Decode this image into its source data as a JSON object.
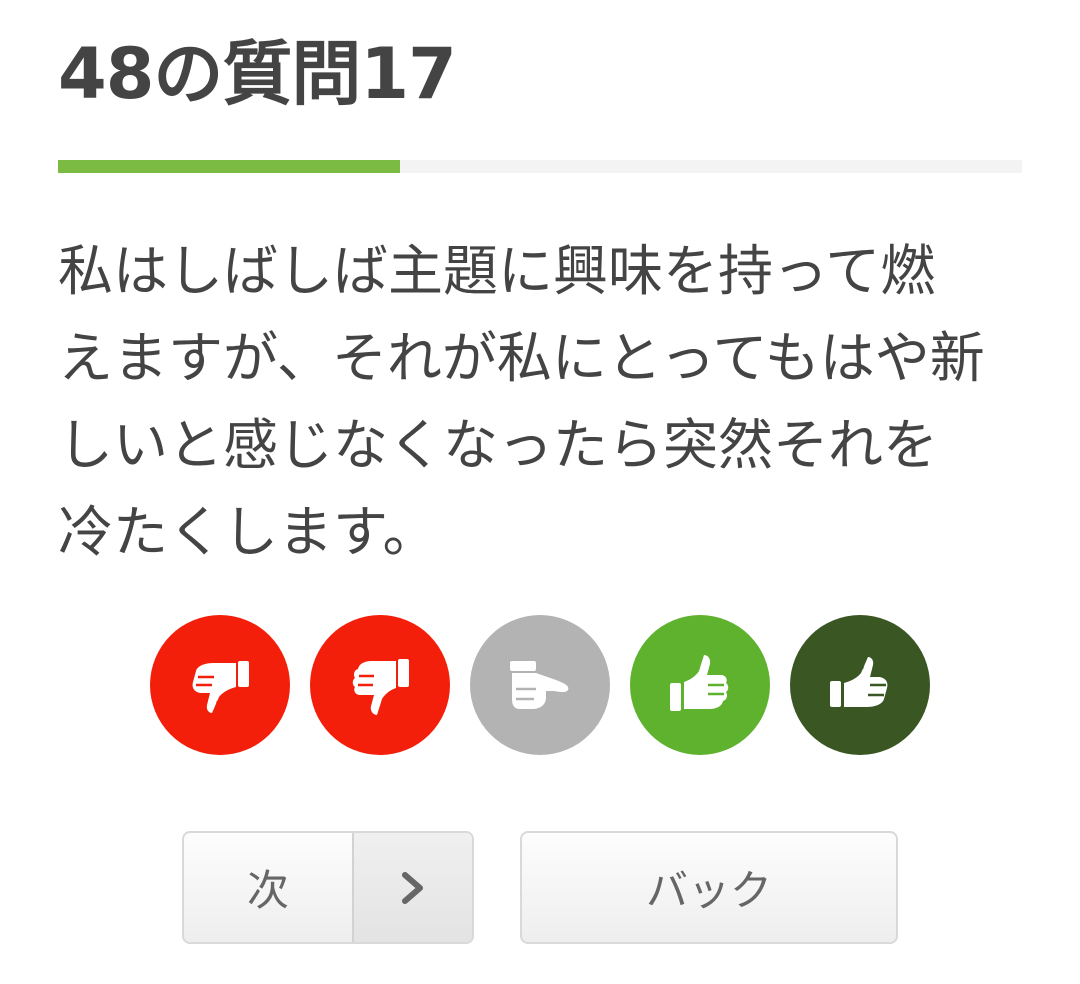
{
  "title": "48の質問17",
  "progress": {
    "fraction": 0.355
  },
  "question": {
    "text": "私はしばしば主題に興味を持って燃えますが、それが私にとってもはや新しいと感じなくなったら突然それを冷たくします。"
  },
  "answers": [
    {
      "icon": "double-thumbs-down-icon",
      "color": "#f41f0a"
    },
    {
      "icon": "thumbs-down-icon",
      "color": "#f41f0a"
    },
    {
      "icon": "thumb-sideways-icon",
      "color": "#b3b3b3"
    },
    {
      "icon": "thumbs-up-icon",
      "color": "#5fb22e"
    },
    {
      "icon": "double-thumbs-up-icon",
      "color": "#3a5623"
    }
  ],
  "buttons": {
    "next_label": "次",
    "next_icon": "chevron-right-icon",
    "back_label": "バック"
  }
}
